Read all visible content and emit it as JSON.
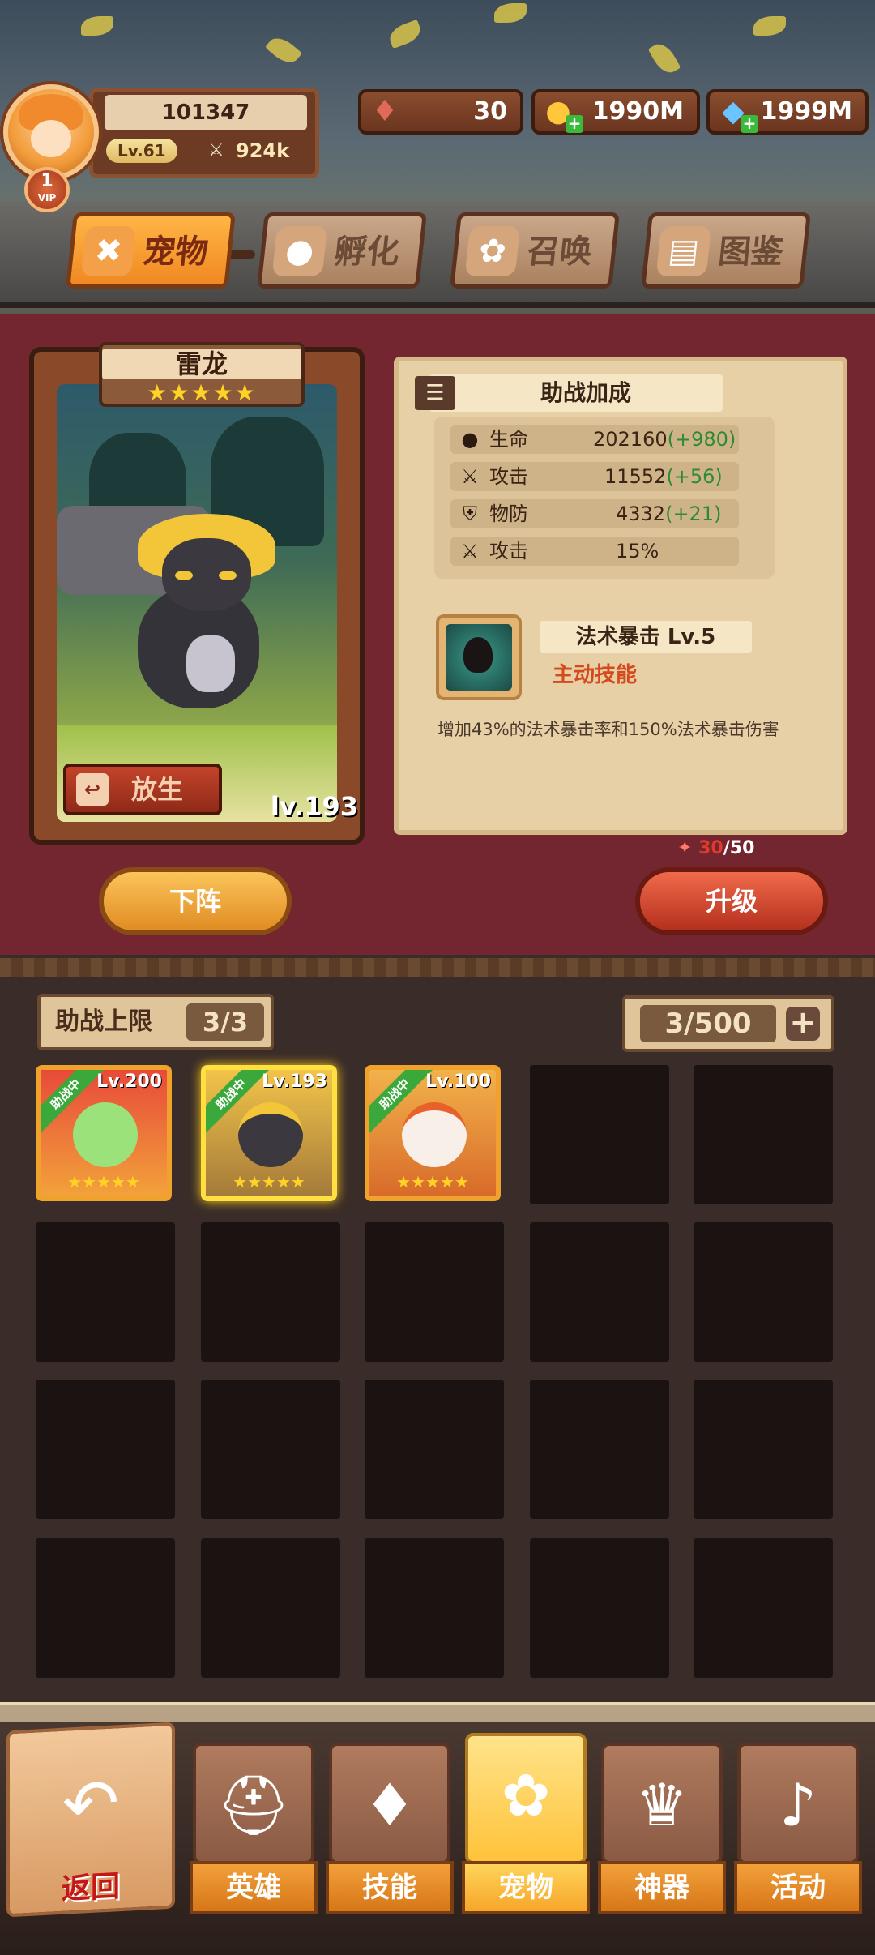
{
  "player": {
    "score": "101347",
    "level": "Lv.61",
    "power": "924k",
    "vip": "1",
    "vip_label": "VIP"
  },
  "resources": [
    {
      "icon": "stamina-icon",
      "value": "30"
    },
    {
      "icon": "gold-coin-icon",
      "value": "1990M"
    },
    {
      "icon": "diamond-icon",
      "value": "1999M"
    }
  ],
  "tabs": [
    {
      "label": "宠物",
      "icon": "fox-icon",
      "active": true
    },
    {
      "label": "孵化",
      "icon": "egg-icon",
      "active": false
    },
    {
      "label": "召唤",
      "icon": "paw-icon",
      "active": false
    },
    {
      "label": "图鉴",
      "icon": "book-icon",
      "active": false
    }
  ],
  "pet": {
    "name": "雷龙",
    "stars": "★★★★★",
    "level": "lv.193",
    "release_label": "放生"
  },
  "bonus": {
    "title": "助战加成",
    "stats": [
      {
        "icon": "drop-icon",
        "name": "生命",
        "value": "202160",
        "bonus": "(+980)"
      },
      {
        "icon": "sword-icon",
        "name": "攻击",
        "value": "11552",
        "bonus": "(+56)"
      },
      {
        "icon": "shield-icon",
        "name": "物防",
        "value": "4332",
        "bonus": "(+21)"
      },
      {
        "icon": "sword-icon",
        "name": "攻击",
        "value": "15%",
        "bonus": ""
      }
    ]
  },
  "skill": {
    "name": "法术暴击 Lv.5",
    "type": "主动技能",
    "desc": "增加43%的法术暴击率和150%法术暴击伤害"
  },
  "upgrade_cost": {
    "current": "30",
    "total": "/50"
  },
  "buttons": {
    "down": "下阵",
    "upgrade": "升级"
  },
  "assist": {
    "limit_label": "助战上限",
    "limit_value": "3/3",
    "capacity": "3/500",
    "add": "+"
  },
  "pets": [
    {
      "level": "Lv.200",
      "badge": "助战中",
      "stars": "★★★★★",
      "color": "#d63a3a",
      "creature": "#9be27a",
      "selected": false
    },
    {
      "level": "Lv.193",
      "badge": "助战中",
      "stars": "★★★★★",
      "color": "#c7a04a",
      "creature": "#3b393f",
      "selected": true
    },
    {
      "level": "Lv.100",
      "badge": "助战中",
      "stars": "★★★★★",
      "color": "#e0863a",
      "creature": "#f8f0e8",
      "selected": false
    }
  ],
  "nav": {
    "back": "返回",
    "items": [
      {
        "label": "英雄",
        "icon": "helmet-icon",
        "active": false
      },
      {
        "label": "技能",
        "icon": "spellbook-icon",
        "active": false
      },
      {
        "label": "宠物",
        "icon": "winged-flower-icon",
        "active": true
      },
      {
        "label": "神器",
        "icon": "artifact-icon",
        "active": false
      },
      {
        "label": "活动",
        "icon": "horn-icon",
        "active": false
      }
    ]
  }
}
